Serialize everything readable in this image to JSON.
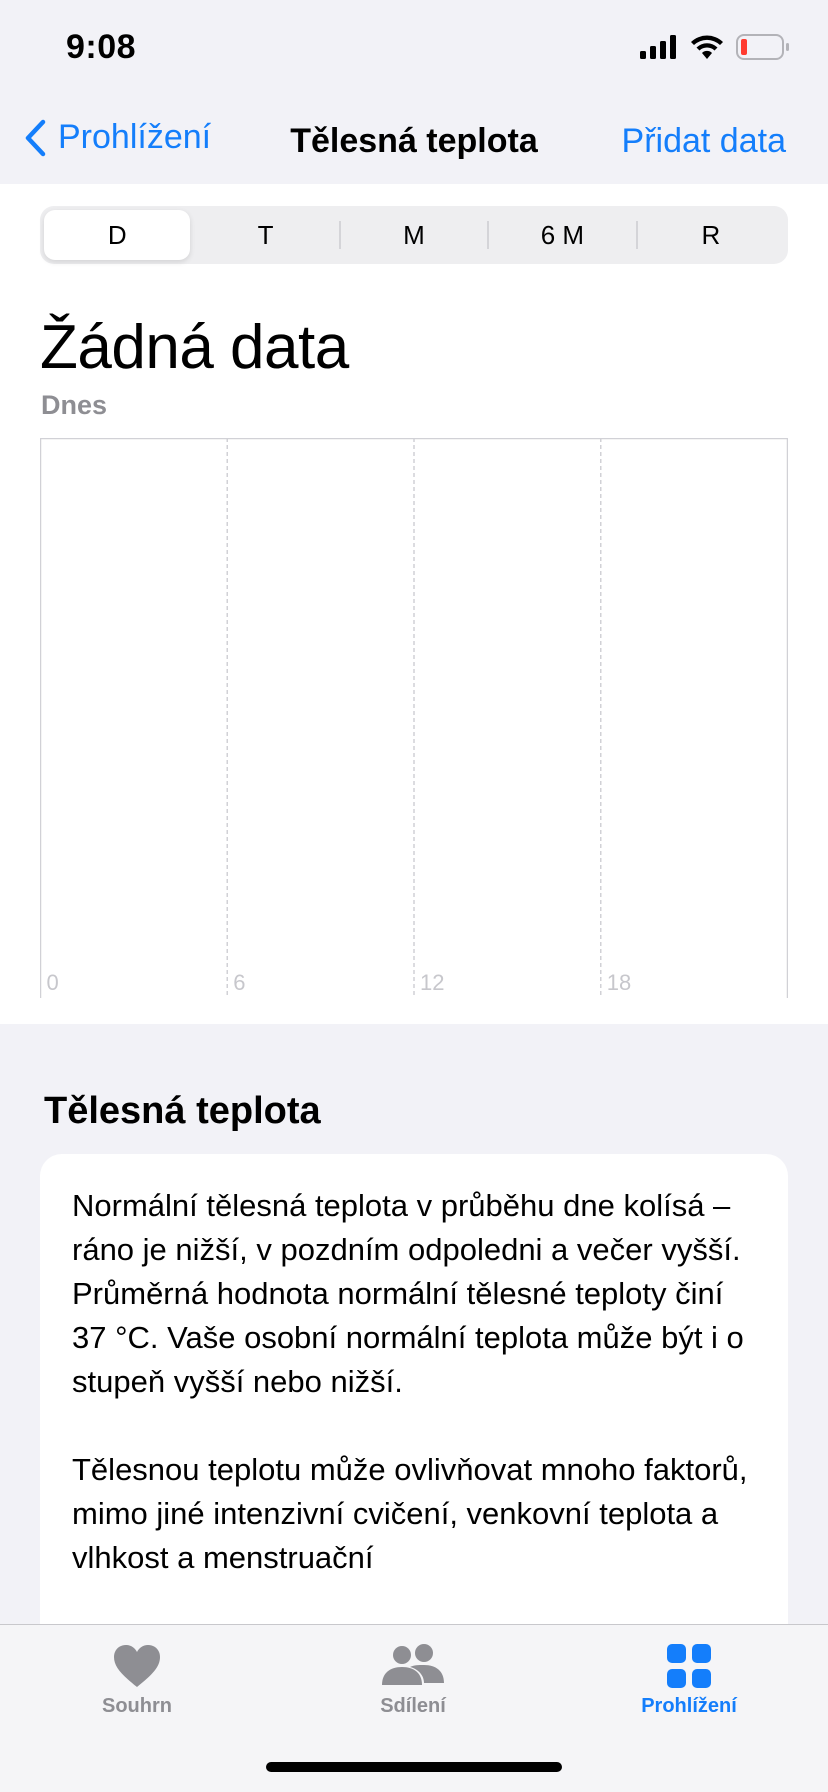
{
  "status": {
    "time": "9:08"
  },
  "nav": {
    "back_label": "Prohlížení",
    "title": "Tělesná teplota",
    "action_label": "Přidat data"
  },
  "segments": [
    "D",
    "T",
    "M",
    "6 M",
    "R"
  ],
  "selected_segment": "D",
  "summary": {
    "value": "Žádná data",
    "period": "Dnes"
  },
  "chart_data": {
    "type": "line",
    "x": [
      0,
      6,
      12,
      18
    ],
    "x_tick_labels": [
      "0",
      "6",
      "12",
      "18"
    ],
    "xlim": [
      0,
      24
    ],
    "series": [],
    "grid": true
  },
  "info": {
    "title": "Tělesná teplota",
    "paragraphs": [
      "Normální tělesná teplota v průběhu dne kolísá – ráno je nižší, v pozdním odpoledni a večer vyšší. Průměrná hodnota normální tělesné teploty činí 37 °C. Vaše osobní normální teplota může být i o stupeň vyšší nebo nižší.",
      "Tělesnou teplotu může ovlivňovat mnoho faktorů, mimo jiné intenzivní cvičení, venkovní teplota a vlhkost a menstruační"
    ]
  },
  "tabs": [
    {
      "label": "Souhrn",
      "icon": "heart-icon"
    },
    {
      "label": "Sdílení",
      "icon": "people-icon"
    },
    {
      "label": "Prohlížení",
      "icon": "grid-icon"
    }
  ],
  "colors": {
    "accent": "#147efb",
    "battery_low": "#ff3b30",
    "inactive": "#8e8e93"
  }
}
